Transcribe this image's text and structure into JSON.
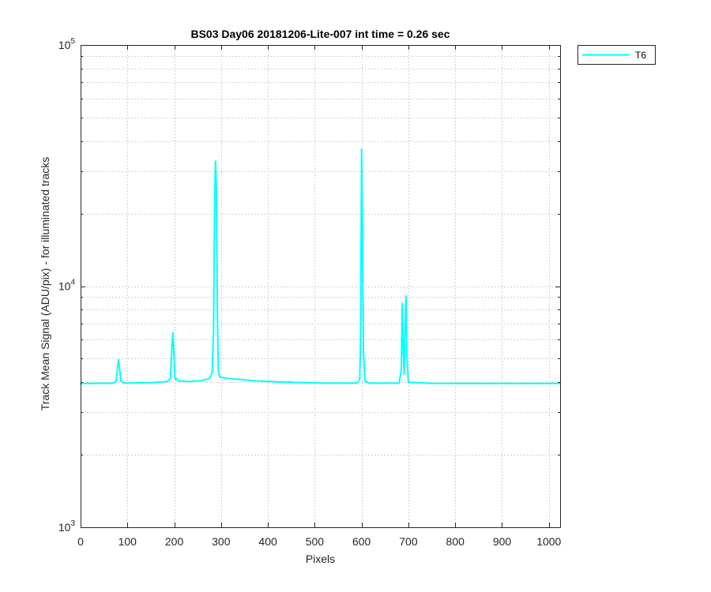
{
  "chart_data": {
    "type": "line",
    "title": "BS03 Day06 20181206-Lite-007 int time = 0.26 sec",
    "xlabel": "Pixels",
    "ylabel": "Track Mean Signal (ADU/pix) - for illuminated tracks",
    "xlim": [
      0,
      1024
    ],
    "ylim": [
      1000,
      100000
    ],
    "yscale": "log",
    "grid": true,
    "minor_grid": true,
    "legend_position": "outside-top-right",
    "x_ticks": [
      "0",
      "100",
      "200",
      "300",
      "400",
      "500",
      "600",
      "700",
      "800",
      "900",
      "1000"
    ],
    "y_ticks": [
      {
        "value": 1000,
        "base": "10",
        "exp": "3"
      },
      {
        "value": 10000,
        "base": "10",
        "exp": "4"
      },
      {
        "value": 100000,
        "base": "10",
        "exp": "5"
      }
    ],
    "series": [
      {
        "name": "T6",
        "color": "#00ffff",
        "points": [
          [
            0,
            3950
          ],
          [
            40,
            3955
          ],
          [
            70,
            3960
          ],
          [
            76,
            4050
          ],
          [
            79,
            4600
          ],
          [
            81,
            4950
          ],
          [
            83,
            4600
          ],
          [
            86,
            4050
          ],
          [
            92,
            3960
          ],
          [
            150,
            3980
          ],
          [
            185,
            4020
          ],
          [
            192,
            4150
          ],
          [
            195,
            5600
          ],
          [
            197,
            6400
          ],
          [
            199,
            5400
          ],
          [
            201,
            4200
          ],
          [
            203,
            4100
          ],
          [
            205,
            4150
          ],
          [
            208,
            4050
          ],
          [
            230,
            4020
          ],
          [
            260,
            4060
          ],
          [
            276,
            4150
          ],
          [
            281,
            4400
          ],
          [
            284,
            6500
          ],
          [
            286,
            20000
          ],
          [
            288,
            33000
          ],
          [
            290,
            26000
          ],
          [
            292,
            8000
          ],
          [
            294,
            4500
          ],
          [
            297,
            4200
          ],
          [
            320,
            4130
          ],
          [
            380,
            4040
          ],
          [
            445,
            3990
          ],
          [
            447,
            4020
          ],
          [
            449,
            3990
          ],
          [
            520,
            3960
          ],
          [
            590,
            3960
          ],
          [
            596,
            4100
          ],
          [
            598,
            6000
          ],
          [
            600,
            37000
          ],
          [
            602,
            18000
          ],
          [
            604,
            5500
          ],
          [
            607,
            4050
          ],
          [
            615,
            3960
          ],
          [
            680,
            3960
          ],
          [
            685,
            4500
          ],
          [
            687,
            8500
          ],
          [
            689,
            5500
          ],
          [
            691,
            4300
          ],
          [
            693,
            7000
          ],
          [
            695,
            9100
          ],
          [
            697,
            5000
          ],
          [
            700,
            4000
          ],
          [
            750,
            3955
          ],
          [
            850,
            3950
          ],
          [
            950,
            3950
          ],
          [
            1024,
            3950
          ]
        ]
      }
    ]
  }
}
